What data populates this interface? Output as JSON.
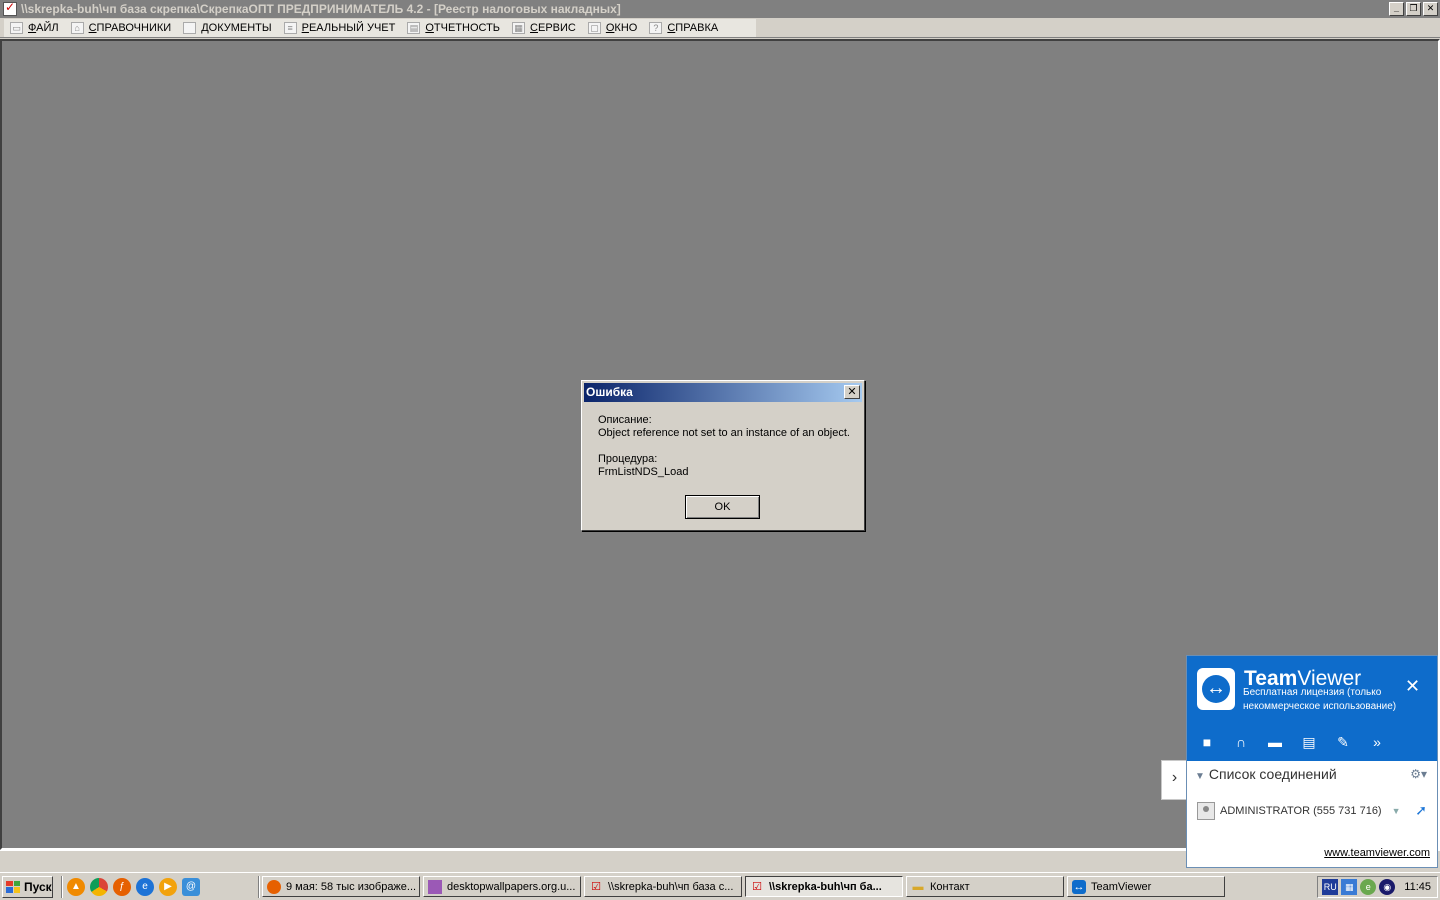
{
  "window": {
    "title": "\\\\skrepka-buh\\чп база скрепка\\СкрепкаОПТ  ПРЕДПРИНИМАТЕЛЬ 4.2 - [Реестр налоговых накладных]",
    "buttons": [
      "minimize",
      "restore",
      "close"
    ]
  },
  "menu": {
    "items": [
      {
        "label": "ФАЙЛ",
        "icon": "folder-open-icon"
      },
      {
        "label": "СПРАВОЧНИКИ",
        "icon": "home-icon"
      },
      {
        "label": "ДОКУМЕНТЫ",
        "icon": "document-icon"
      },
      {
        "label": "РЕАЛЬНЫЙ УЧЕТ",
        "icon": "ledger-icon"
      },
      {
        "label": "ОТЧЕТНОСТЬ",
        "icon": "report-icon"
      },
      {
        "label": "СЕРВИС",
        "icon": "service-icon"
      },
      {
        "label": "ОКНО",
        "icon": "window-icon"
      },
      {
        "label": "СПРАВКА",
        "icon": "help-icon"
      }
    ]
  },
  "dialog": {
    "title": "Ошибка",
    "description_label": "Описание:",
    "description": "Object reference not set to an instance of an object.",
    "procedure_label": "Процедура:",
    "procedure": "FrmListNDS_Load",
    "ok_label": "OK"
  },
  "teamviewer": {
    "brand_bold": "Team",
    "brand_light": "Viewer",
    "license": "Бесплатная лицензия (только некоммерческое использование)",
    "tools": [
      "video-icon",
      "headset-icon",
      "chat-icon",
      "files-icon",
      "whiteboard-icon",
      "more-icon"
    ],
    "section_title": "Список соединений",
    "connection": "ADMINISTRATOR (555 731 716)",
    "link": "www.teamviewer.com",
    "brand_color": "#0e6ccb"
  },
  "taskbar": {
    "start_label": "Пуск",
    "quick_launch": [
      "avast-icon",
      "chrome-icon",
      "firefox-icon",
      "ie-icon",
      "media-player-icon",
      "browser-icon"
    ],
    "tasks": [
      {
        "label": "9 мая: 58 тыс изображе...",
        "icon": "firefox-icon",
        "active": false
      },
      {
        "label": "desktopwallpapers.org.u...",
        "icon": "winrar-icon",
        "active": false
      },
      {
        "label": "\\\\skrepka-buh\\чп база с...",
        "icon": "skrepka-icon",
        "active": false
      },
      {
        "label": "\\\\skrepka-buh\\чп ба...",
        "icon": "skrepka-icon",
        "active": true
      },
      {
        "label": "Контакт",
        "icon": "folder-icon",
        "active": false
      },
      {
        "label": "TeamViewer",
        "icon": "teamviewer-icon",
        "active": false
      }
    ],
    "tray_lang": "RU",
    "clock": "11:45"
  }
}
